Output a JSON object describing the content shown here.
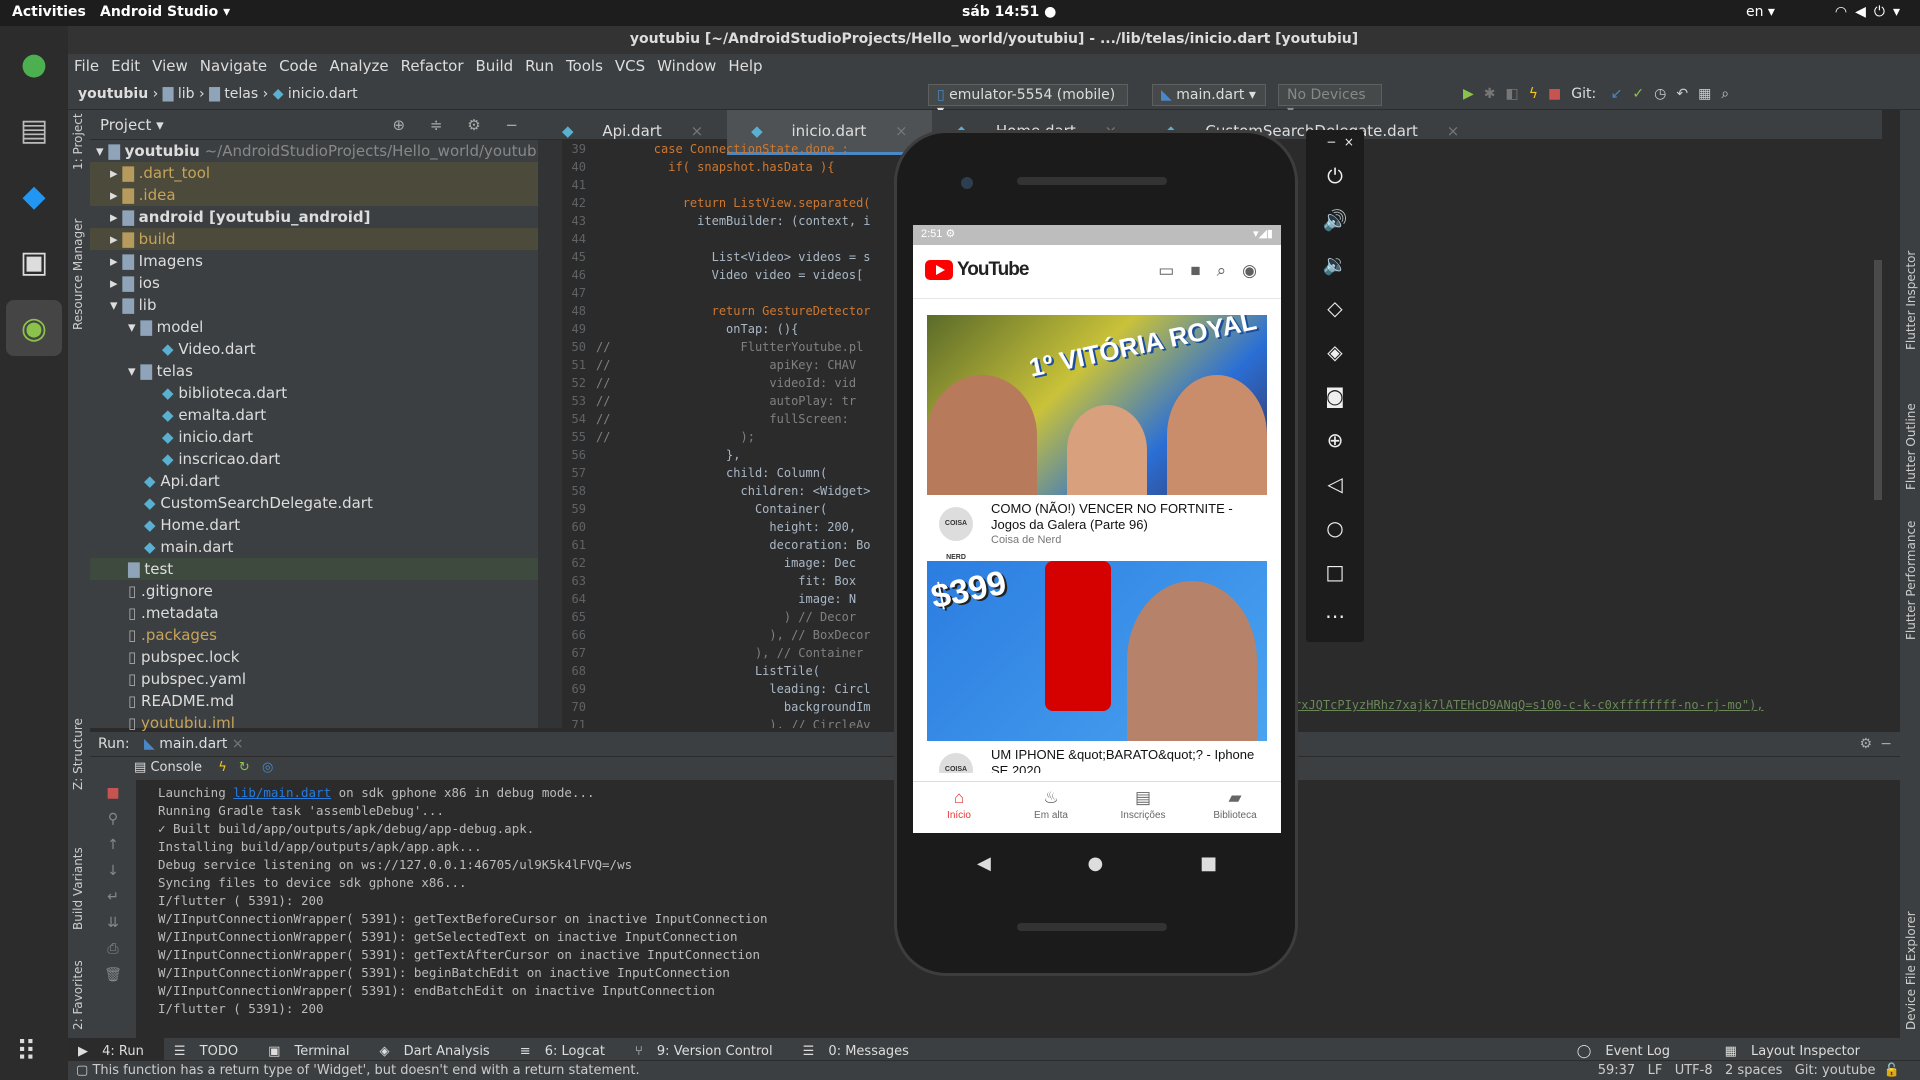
{
  "topbar": {
    "activities": "Activities",
    "app": "Android Studio ▾",
    "clock": "sáb 14:51 ●",
    "lang": "en ▾"
  },
  "window": {
    "title": "youtubiu [~/AndroidStudioProjects/Hello_world/youtubiu] - .../lib/telas/inicio.dart [youtubiu]"
  },
  "menu": [
    "File",
    "Edit",
    "View",
    "Navigate",
    "Code",
    "Analyze",
    "Refactor",
    "Build",
    "Run",
    "Tools",
    "VCS",
    "Window",
    "Help"
  ],
  "nav": {
    "crumb1": "youtubiu",
    "crumb2": "lib",
    "crumb3": "telas",
    "crumb4": "inicio.dart",
    "device": "emulator-5554 (mobile) ▾",
    "config": "main.dart ▾",
    "nodevices": "No Devices ▾",
    "git": "Git:"
  },
  "project": {
    "title": "Project ▾",
    "rows": [
      {
        "label": "youtubiu",
        "suffix": " ~/AndroidStudioProjects/Hello_world/youtubiu"
      },
      {
        "label": ".dart_tool"
      },
      {
        "label": ".idea"
      },
      {
        "label": "android [youtubiu_android]"
      },
      {
        "label": "build"
      },
      {
        "label": "Imagens"
      },
      {
        "label": "ios"
      },
      {
        "label": "lib"
      },
      {
        "label": "model"
      },
      {
        "label": "Video.dart"
      },
      {
        "label": "telas"
      },
      {
        "label": "biblioteca.dart"
      },
      {
        "label": "emalta.dart"
      },
      {
        "label": "inicio.dart"
      },
      {
        "label": "inscricao.dart"
      },
      {
        "label": "Api.dart"
      },
      {
        "label": "CustomSearchDelegate.dart"
      },
      {
        "label": "Home.dart"
      },
      {
        "label": "main.dart"
      },
      {
        "label": "test"
      },
      {
        "label": ".gitignore"
      },
      {
        "label": ".metadata"
      },
      {
        "label": ".packages"
      },
      {
        "label": "pubspec.lock"
      },
      {
        "label": "pubspec.yaml"
      },
      {
        "label": "README.md"
      },
      {
        "label": "youtubiu.iml"
      }
    ]
  },
  "editor": {
    "tabs": [
      "Api.dart",
      "inicio.dart",
      "Home.dart",
      "CustomSearchDelegate.dart"
    ],
    "code": [
      {
        "n": "39",
        "t": "        case ConnectionState.done :"
      },
      {
        "n": "40",
        "t": "          if( snapshot.hasData ){"
      },
      {
        "n": "41",
        "t": ""
      },
      {
        "n": "42",
        "t": "            return ListView.separated("
      },
      {
        "n": "43",
        "t": "              itemBuilder: (context, i"
      },
      {
        "n": "44",
        "t": ""
      },
      {
        "n": "45",
        "t": "                List<Video> videos = s"
      },
      {
        "n": "46",
        "t": "                Video video = videos["
      },
      {
        "n": "47",
        "t": ""
      },
      {
        "n": "48",
        "t": "                return GestureDetector"
      },
      {
        "n": "49",
        "t": "                  onTap: (){"
      },
      {
        "n": "50",
        "t": "//                  FlutterYoutube.pl"
      },
      {
        "n": "51",
        "t": "//                      apiKey: CHAV"
      },
      {
        "n": "52",
        "t": "//                      videoId: vid"
      },
      {
        "n": "53",
        "t": "//                      autoPlay: tr"
      },
      {
        "n": "54",
        "t": "//                      fullScreen:"
      },
      {
        "n": "55",
        "t": "//                  );"
      },
      {
        "n": "56",
        "t": "                  },"
      },
      {
        "n": "57",
        "t": "                  child: Column("
      },
      {
        "n": "58",
        "t": "                    children: <Widget>"
      },
      {
        "n": "59",
        "t": "                      Container("
      },
      {
        "n": "60",
        "t": "                        height: 200,"
      },
      {
        "n": "61",
        "t": "                        decoration: Bo"
      },
      {
        "n": "62",
        "t": "                          image: Dec"
      },
      {
        "n": "63",
        "t": "                            fit: Box"
      },
      {
        "n": "64",
        "t": "                            image: N"
      },
      {
        "n": "65",
        "t": "                          ) // Decor"
      },
      {
        "n": "66",
        "t": "                        ), // BoxDecor"
      },
      {
        "n": "67",
        "t": "                      ), // Container"
      },
      {
        "n": "68",
        "t": "                      ListTile("
      },
      {
        "n": "69",
        "t": "                        leading: Circl"
      },
      {
        "n": "70",
        "t": "                          backgroundIm"
      },
      {
        "n": "71",
        "t": "                        ), // CircleAv"
      }
    ],
    "overflow_url": "rxJQTcPIyzHRhz7xajk7lATEHcD9ANqQ=s100-c-k-c0xffffffff-no-rj-mo\"),"
  },
  "run": {
    "label": "Run:",
    "config_tab": "main.dart",
    "console_tab": "Console",
    "link": "lib/main.dart",
    "lines": [
      "Running Gradle task 'assembleDebug'...",
      "✓ Built build/app/outputs/apk/debug/app-debug.apk.",
      "Installing build/app/outputs/apk/app.apk...",
      "Debug service listening on ws://127.0.0.1:46705/ul9K5k4lFVQ=/ws",
      "Syncing files to device sdk gphone x86...",
      "I/flutter ( 5391): 200",
      "W/IInputConnectionWrapper( 5391): getTextBeforeCursor on inactive InputConnection",
      "W/IInputConnectionWrapper( 5391): getSelectedText on inactive InputConnection",
      "W/IInputConnectionWrapper( 5391): getTextAfterCursor on inactive InputConnection",
      "W/IInputConnectionWrapper( 5391): beginBatchEdit on inactive InputConnection",
      "W/IInputConnectionWrapper( 5391): endBatchEdit on inactive InputConnection",
      "I/flutter ( 5391): 200"
    ],
    "first_line_prefix": "Launching ",
    "first_line_suffix": " on sdk gphone x86 in debug mode..."
  },
  "bottom_tabs": [
    "4: Run",
    "TODO",
    "Terminal",
    "Dart Analysis",
    "6: Logcat",
    "9: Version Control",
    "0: Messages"
  ],
  "bottom_right": [
    "Event Log",
    "Layout Inspector"
  ],
  "status": {
    "message": "This function has a return type of 'Widget', but doesn't end with a return statement.",
    "pos": "59:37",
    "lf": "LF",
    "enc": "UTF-8",
    "indent": "2 spaces",
    "git": "Git: youtube"
  },
  "side_labels": {
    "project": "1: Project",
    "resource": "Resource Manager",
    "structure": "Z: Structure",
    "variants": "Build Variants",
    "favorites": "2: Favorites",
    "inspector": "Flutter Inspector",
    "outline": "Flutter Outline",
    "performance": "Flutter Performance",
    "explorer": "Device File Explorer"
  },
  "phone": {
    "time": "2:51",
    "app_name": "YouTube",
    "videos": [
      {
        "title": "COMO (NÃO!) VENCER NO FORTNITE - Jogos da Galera (Parte 96)",
        "channel": "Coisa de Nerd",
        "thumb_text": "1º VITÓRIA ROYAL",
        "avatar": "COISA NERD"
      },
      {
        "title": "UM IPHONE &quot;BARATO&quot;? - Iphone SE 2020",
        "channel": "",
        "thumb_text": "$399",
        "avatar": "COISA NERD"
      }
    ],
    "nav": [
      {
        "label": "Início",
        "icon": "home-icon",
        "active": true
      },
      {
        "label": "Em alta",
        "icon": "fire-icon",
        "active": false
      },
      {
        "label": "Inscrições",
        "icon": "subscriptions-icon",
        "active": false
      },
      {
        "label": "Biblioteca",
        "icon": "library-icon",
        "active": false
      }
    ]
  },
  "colors": {
    "accent": "#4a88c7",
    "yt_red": "#ff0000",
    "active_nav": "#e53935"
  }
}
